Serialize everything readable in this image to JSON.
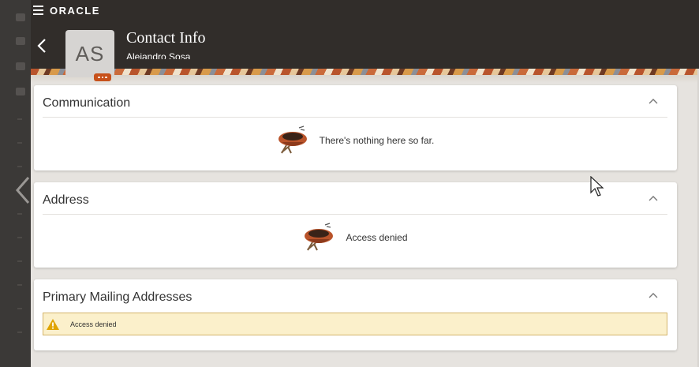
{
  "header": {
    "brand": "ORACLE",
    "title": "Contact Info",
    "subtitle": "Alejandro Sosa",
    "avatar_initials": "AS",
    "icons": {
      "menu": "hamburger-icon",
      "back": "chevron-left-icon",
      "more": "ellipsis-icon"
    }
  },
  "sections": [
    {
      "title": "Communication",
      "message": "There's nothing here so far.",
      "icon": "empty-nest-icon"
    },
    {
      "title": "Address",
      "message": "Access denied",
      "icon": "empty-nest-icon"
    },
    {
      "title": "Primary Mailing Addresses",
      "warning": "Access denied",
      "icon": "warning-icon"
    }
  ],
  "colors": {
    "header_bg": "#312d2a",
    "accent": "#c7511b",
    "warning_bg": "#fbf0cb",
    "warning_border": "#d4b46a",
    "warning_icon": "#e0a400"
  }
}
